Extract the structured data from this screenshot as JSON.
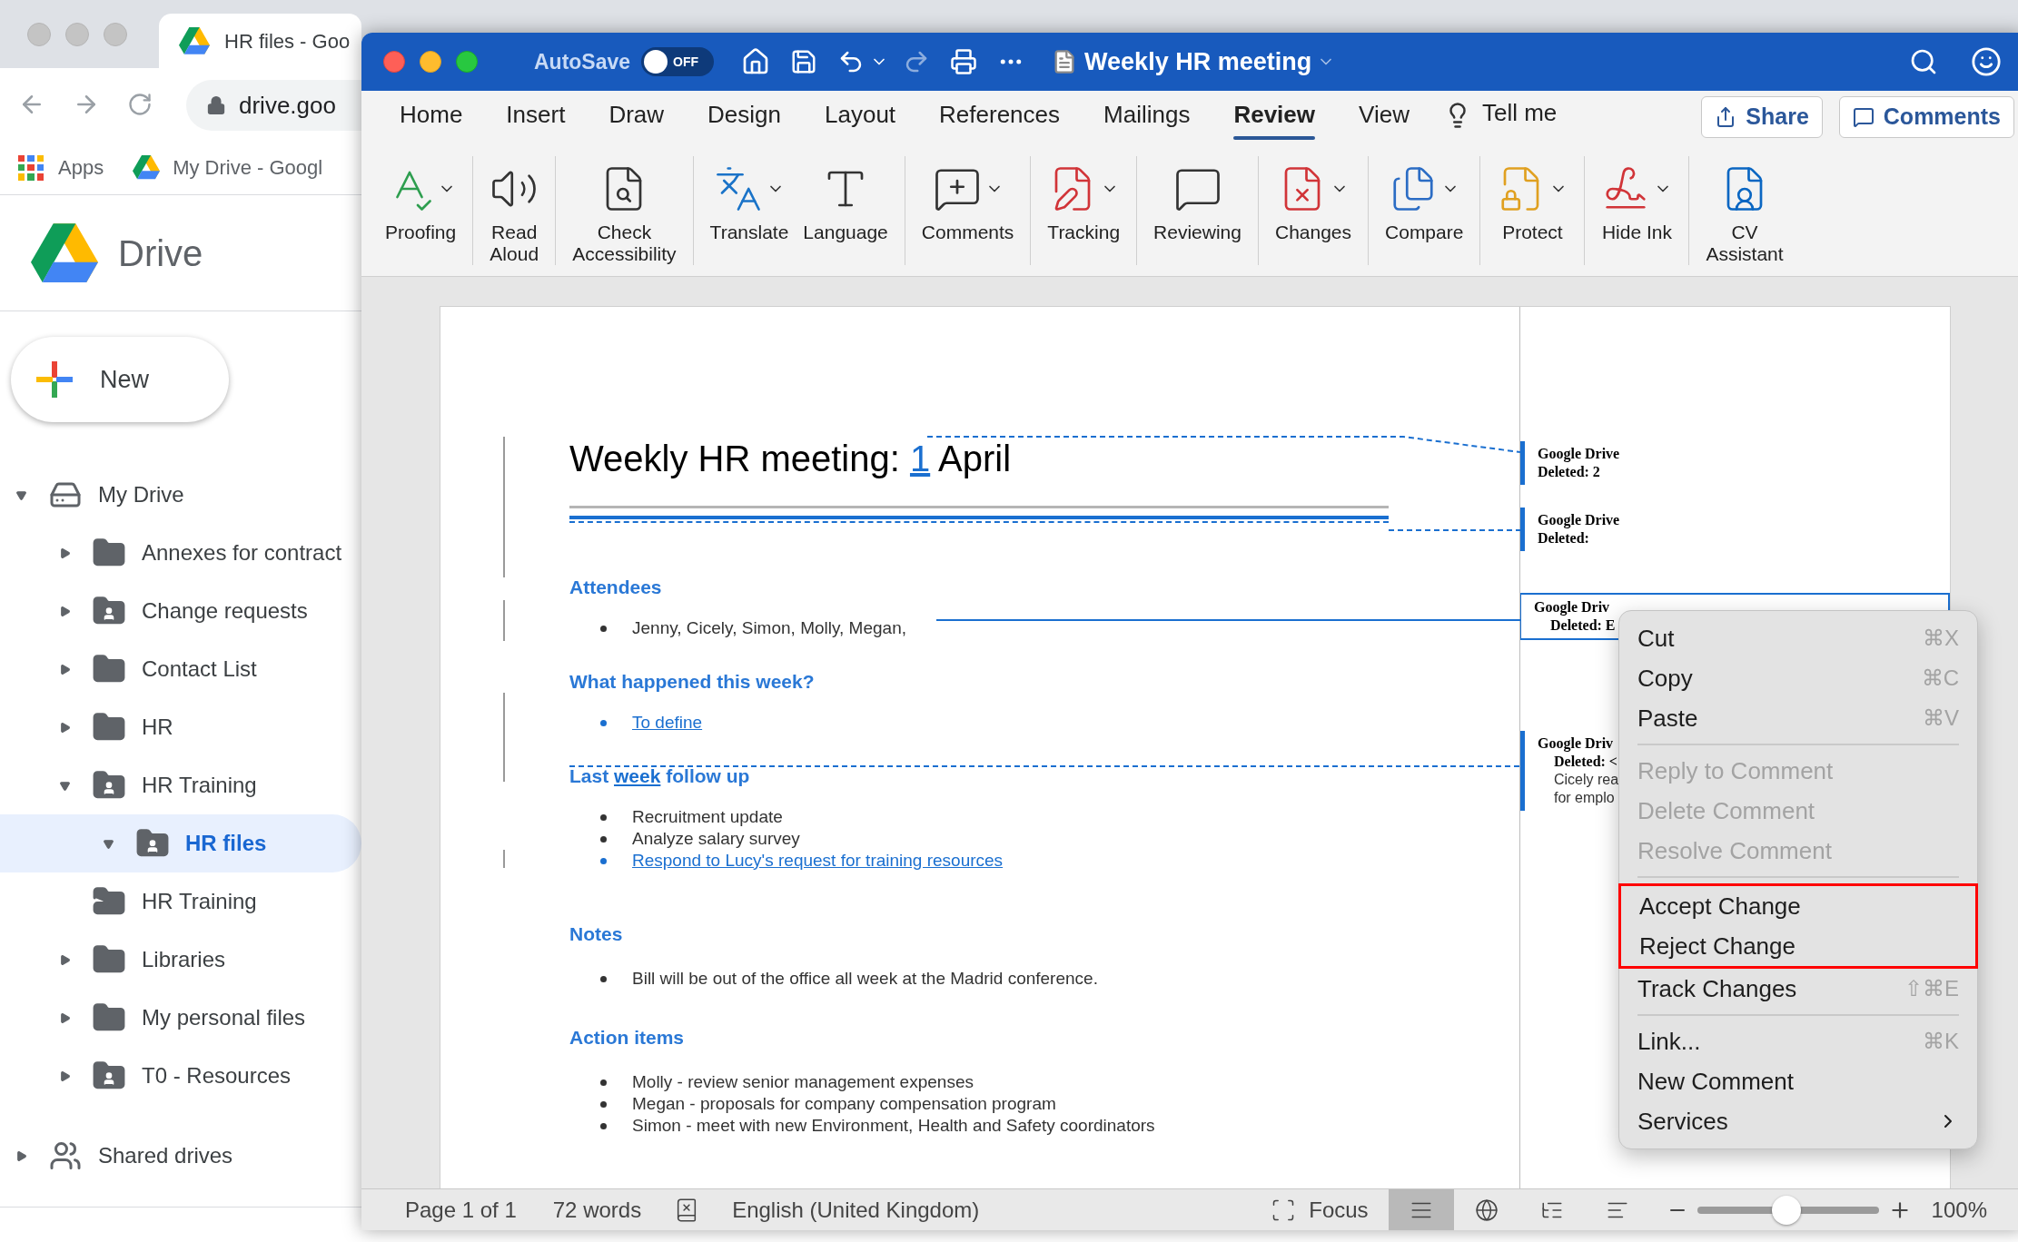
{
  "browser": {
    "tab_title": "HR files - Goo",
    "url": "drive.goo",
    "bookmarks": [
      "Apps",
      "My Drive - Googl"
    ],
    "drive": {
      "logo_text": "Drive",
      "new_button": "New",
      "tree": [
        {
          "label": "My Drive",
          "kind": "drive",
          "expanded": true,
          "selected": false,
          "children": [
            {
              "label": "Annexes for contract",
              "kind": "folder",
              "expanded": false,
              "selected": false
            },
            {
              "label": "Change requests",
              "kind": "shared",
              "expanded": false,
              "selected": false
            },
            {
              "label": "Contact List",
              "kind": "folder",
              "expanded": false,
              "selected": false
            },
            {
              "label": "HR",
              "kind": "folder",
              "expanded": false,
              "selected": false
            },
            {
              "label": "HR Training",
              "kind": "shared",
              "expanded": true,
              "selected": false,
              "children": [
                {
                  "label": "HR files",
                  "kind": "shared",
                  "expanded": true,
                  "selected": true
                }
              ]
            },
            {
              "label": "HR Training",
              "kind": "shortcut",
              "selected": false
            },
            {
              "label": "Libraries",
              "kind": "folder",
              "expanded": false,
              "selected": false
            },
            {
              "label": "My personal files",
              "kind": "folder",
              "expanded": false,
              "selected": false
            },
            {
              "label": "T0 - Resources",
              "kind": "shared",
              "expanded": false,
              "selected": false
            }
          ]
        },
        {
          "label": "Shared drives",
          "kind": "shared-drives",
          "expanded": false,
          "selected": false
        }
      ]
    }
  },
  "word": {
    "autosave": {
      "label": "AutoSave",
      "on": false,
      "state_text": "OFF"
    },
    "doc_title": "Weekly HR meeting",
    "tabs": [
      {
        "label": "Home",
        "selected": false
      },
      {
        "label": "Insert",
        "selected": false
      },
      {
        "label": "Draw",
        "selected": false
      },
      {
        "label": "Design",
        "selected": false
      },
      {
        "label": "Layout",
        "selected": false
      },
      {
        "label": "References",
        "selected": false
      },
      {
        "label": "Mailings",
        "selected": false
      },
      {
        "label": "Review",
        "selected": true
      },
      {
        "label": "View",
        "selected": false
      }
    ],
    "tell_me": "Tell me",
    "share_button": "Share",
    "comments_button": "Comments",
    "ribbon": [
      [
        {
          "kind": "proofing",
          "lines": [
            "Proofing"
          ],
          "dropdown": true
        }
      ],
      [
        {
          "kind": "read-aloud",
          "lines": [
            "Read",
            "Aloud"
          ],
          "dropdown": false
        }
      ],
      [
        {
          "kind": "accessibility",
          "lines": [
            "Check",
            "Accessibility"
          ],
          "dropdown": false
        }
      ],
      [
        {
          "kind": "translate",
          "lines": [
            "Translate"
          ],
          "dropdown": true
        },
        {
          "kind": "language",
          "lines": [
            "Language"
          ],
          "dropdown": false
        }
      ],
      [
        {
          "kind": "comments",
          "lines": [
            "Comments"
          ],
          "dropdown": true
        }
      ],
      [
        {
          "kind": "tracking",
          "lines": [
            "Tracking"
          ],
          "dropdown": true
        }
      ],
      [
        {
          "kind": "reviewing",
          "lines": [
            "Reviewing"
          ],
          "dropdown": false
        }
      ],
      [
        {
          "kind": "changes",
          "lines": [
            "Changes"
          ],
          "dropdown": true
        }
      ],
      [
        {
          "kind": "compare",
          "lines": [
            "Compare"
          ],
          "dropdown": true
        }
      ],
      [
        {
          "kind": "protect",
          "lines": [
            "Protect"
          ],
          "dropdown": true
        }
      ],
      [
        {
          "kind": "ink",
          "lines": [
            "Hide Ink"
          ],
          "dropdown": true
        }
      ],
      [
        {
          "kind": "cv",
          "lines": [
            "CV",
            "Assistant"
          ],
          "dropdown": false
        }
      ]
    ],
    "document": {
      "title": [
        {
          "text": "Weekly HR meeting: ",
          "inserted": false
        },
        {
          "text": "1",
          "inserted": true
        },
        {
          "text": " April",
          "inserted": false
        }
      ],
      "sections": [
        {
          "heading": [
            {
              "text": "Attendees",
              "inserted": false
            }
          ],
          "items": [
            {
              "text": "Jenny, Cicely, Simon, Molly, Megan,",
              "inserted": false
            }
          ]
        },
        {
          "heading": [
            {
              "text": "What happened this week?",
              "inserted": false
            }
          ],
          "items": [
            {
              "text": "To define",
              "inserted": true
            }
          ]
        },
        {
          "heading": [
            {
              "text": "Last ",
              "inserted": false
            },
            {
              "text": "week",
              "inserted": true
            },
            {
              "text": " follow up",
              "inserted": false
            }
          ],
          "items": [
            {
              "text": "Recruitment update",
              "inserted": false
            },
            {
              "text": "Analyze salary survey",
              "inserted": false
            },
            {
              "text": "Respond to Lucy's request for training resources",
              "inserted": true
            }
          ]
        },
        {
          "heading": [
            {
              "text": "Notes",
              "inserted": false
            }
          ],
          "items": [
            {
              "text": "Bill will be out of the office all week at the Madrid conference.",
              "inserted": false
            }
          ]
        },
        {
          "heading": [
            {
              "text": "Action items",
              "inserted": false
            }
          ],
          "items": [
            {
              "text": "Molly - review senior management expenses",
              "inserted": false
            },
            {
              "text": "Megan - proposals for company compensation program",
              "inserted": false
            },
            {
              "text": "Simon - meet with new Environment, Health and Safety coordinators",
              "inserted": false
            }
          ]
        }
      ]
    },
    "balloons": [
      {
        "author": "Google Drive",
        "lines": [
          "Deleted: 2"
        ],
        "selected": false
      },
      {
        "author": "Google Drive",
        "lines": [
          "Deleted:"
        ],
        "selected": false
      },
      {
        "author": "Google Driv",
        "lines": [
          "Deleted: E"
        ],
        "selected": true
      },
      {
        "author": "Google Driv",
        "lines": [
          "Deleted: <"
        ],
        "note": [
          "Cicely rea",
          "for emplo"
        ],
        "selected": false
      }
    ],
    "context_menu": [
      {
        "items": [
          {
            "label": "Cut",
            "shortcut": "⌘X",
            "disabled": false,
            "highlighted": false
          },
          {
            "label": "Copy",
            "shortcut": "⌘C",
            "disabled": false,
            "highlighted": false
          },
          {
            "label": "Paste",
            "shortcut": "⌘V",
            "disabled": false,
            "highlighted": false
          }
        ]
      },
      {
        "items": [
          {
            "label": "Reply to Comment",
            "disabled": true,
            "highlighted": false
          },
          {
            "label": "Delete Comment",
            "disabled": true,
            "highlighted": false
          },
          {
            "label": "Resolve Comment",
            "disabled": true,
            "highlighted": false
          }
        ]
      },
      {
        "items": [
          {
            "label": "Accept Change",
            "disabled": false,
            "highlighted": true
          },
          {
            "label": "Reject Change",
            "disabled": false,
            "highlighted": true
          },
          {
            "label": "Track Changes",
            "shortcut": "⇧⌘E",
            "disabled": false,
            "highlighted": false
          }
        ]
      },
      {
        "items": [
          {
            "label": "Link...",
            "shortcut": "⌘K",
            "disabled": false,
            "highlighted": false
          },
          {
            "label": "New Comment",
            "disabled": false,
            "highlighted": false
          },
          {
            "label": "Services",
            "submenu": true,
            "disabled": false,
            "highlighted": false
          }
        ]
      }
    ],
    "status_bar": {
      "page": "Page 1 of 1",
      "words": "72 words",
      "language": "English (United Kingdom)",
      "focus": "Focus",
      "views": [
        {
          "kind": "print",
          "selected": true
        },
        {
          "kind": "web",
          "selected": false
        },
        {
          "kind": "outline",
          "selected": false
        },
        {
          "kind": "draft",
          "selected": false
        }
      ],
      "zoom": {
        "level": 0.49,
        "reading": "100%"
      }
    }
  }
}
